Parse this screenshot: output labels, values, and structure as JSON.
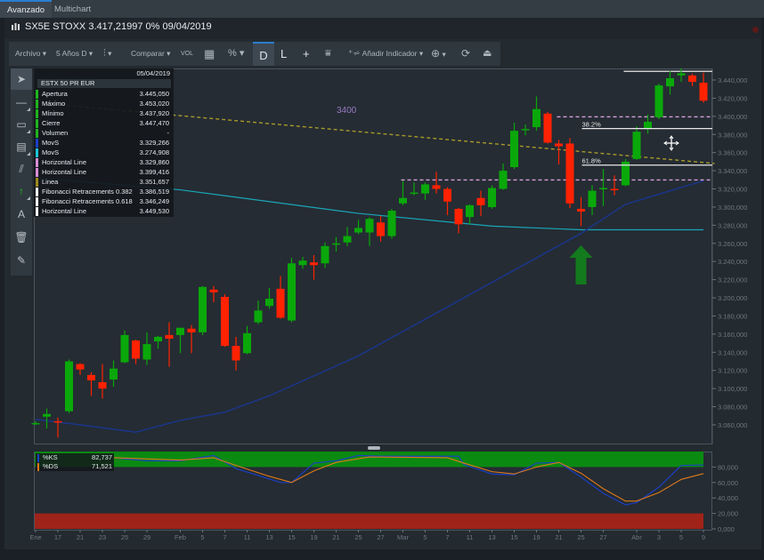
{
  "tabs": [
    {
      "label": "Avanzado",
      "active": true
    },
    {
      "label": "Multichart",
      "active": false
    }
  ],
  "header": {
    "title": "SX5E STOXX 3.417,21997 0% 09/04/2019"
  },
  "toolbar": {
    "archivo": "Archivo ▾",
    "periodo": "5 Años D ▾",
    "chart_type_caret": "▾",
    "comparar": "Comparar ▾",
    "vol": "VOL",
    "percent": "% ▾",
    "d": "D",
    "l": "L",
    "plus": "+",
    "indicator": "Añadir Indicador ▾",
    "zoom_caret": "▾"
  },
  "left_tools": [
    "cursor-icon",
    "line-icon",
    "rectangle-icon",
    "fibonacci-icon",
    "parallel-lines-icon",
    "arrow-up-icon",
    "text-icon",
    "trash-icon",
    "eraser-icon"
  ],
  "panel": {
    "date": "05/04/2019",
    "symbol": "ESTX 50 PR EUR",
    "rows": [
      {
        "label": "Apertura",
        "value": "3.445,050",
        "color": "#1fb41f"
      },
      {
        "label": "Máximo",
        "value": "3.453,020",
        "color": "#1fb41f"
      },
      {
        "label": "Mínimo",
        "value": "3.437,920",
        "color": "#1fb41f"
      },
      {
        "label": "Cierre",
        "value": "3.447,470",
        "color": "#1fb41f"
      },
      {
        "label": "Volumen",
        "value": "-",
        "color": "#1fb41f"
      },
      {
        "label": "MovS",
        "value": "3.329,266",
        "color": "#1b3fc4"
      },
      {
        "label": "MovS",
        "value": "3.274,908",
        "color": "#1cc4d8"
      },
      {
        "label": "Horizontal Line",
        "value": "3.329,860",
        "color": "#d88ed6"
      },
      {
        "label": "Horizontal Line",
        "value": "3.399,416",
        "color": "#d88ed6"
      },
      {
        "label": "Linea",
        "value": "3.351,657",
        "color": "#9c8a1c"
      },
      {
        "label": "Fibonacci Retracements 0.382",
        "value": "3.386,519",
        "color": "#f2f2f2"
      },
      {
        "label": "Fibonacci Retracements 0.618",
        "value": "3.346,249",
        "color": "#f2f2f2"
      },
      {
        "label": "Horizontal Line",
        "value": "3.449,530",
        "color": "#f2f2f2"
      }
    ]
  },
  "osc_legend": [
    {
      "label": "%KS",
      "value": "82,737",
      "color": "#1b3fc4"
    },
    {
      "label": "%DS",
      "value": "71,521",
      "color": "#e07a1a"
    }
  ],
  "annotations": {
    "price_label": "3400",
    "fib_382": "38.2%",
    "fib_618": "61.8%"
  },
  "colors": {
    "up": "#0aa80a",
    "down": "#ff2200",
    "ma_long": "#1b3585",
    "ma_short": "#1aa6b8",
    "trend": "#a89a2a",
    "hline": "#d7a0dd",
    "white": "#e8e8e8",
    "overbought": "#0b8a12",
    "oversold": "#a0231a"
  },
  "chart_data": {
    "type": "candlestick",
    "ylim": [
      3040,
      3460
    ],
    "yticks": [
      3440,
      3420,
      3400,
      3380,
      3360,
      3340,
      3320,
      3300,
      3280,
      3260,
      3240,
      3220,
      3200,
      3180,
      3160,
      3140,
      3120,
      3100,
      3080,
      3060
    ],
    "ytick_labels": [
      "3.440,000",
      "3.420,000",
      "3.400,000",
      "3.380,000",
      "3.360,000",
      "3.340,000",
      "3.320,000",
      "3.300,000",
      "3.280,000",
      "3.260,000",
      "3.240,000",
      "3.220,000",
      "3.200,000",
      "3.180,000",
      "3.160,000",
      "3.140,000",
      "3.120,000",
      "3.100,000",
      "3.080,000",
      "3.060,000"
    ],
    "xticks": [
      {
        "i": 0,
        "label": "Ene"
      },
      {
        "i": 2,
        "label": "17"
      },
      {
        "i": 4,
        "label": "21"
      },
      {
        "i": 6,
        "label": "23"
      },
      {
        "i": 8,
        "label": "25"
      },
      {
        "i": 10,
        "label": "29"
      },
      {
        "i": 13,
        "label": "Feb"
      },
      {
        "i": 15,
        "label": "5"
      },
      {
        "i": 17,
        "label": "7"
      },
      {
        "i": 19,
        "label": "11"
      },
      {
        "i": 21,
        "label": "13"
      },
      {
        "i": 23,
        "label": "15"
      },
      {
        "i": 25,
        "label": "19"
      },
      {
        "i": 27,
        "label": "21"
      },
      {
        "i": 29,
        "label": "25"
      },
      {
        "i": 31,
        "label": "27"
      },
      {
        "i": 33,
        "label": "Mar"
      },
      {
        "i": 35,
        "label": "5"
      },
      {
        "i": 37,
        "label": "7"
      },
      {
        "i": 39,
        "label": "11"
      },
      {
        "i": 41,
        "label": "13"
      },
      {
        "i": 43,
        "label": "15"
      },
      {
        "i": 45,
        "label": "19"
      },
      {
        "i": 47,
        "label": "21"
      },
      {
        "i": 49,
        "label": "25"
      },
      {
        "i": 51,
        "label": "27"
      },
      {
        "i": 54,
        "label": "Abr"
      },
      {
        "i": 56,
        "label": "3"
      },
      {
        "i": 58,
        "label": "5"
      },
      {
        "i": 60,
        "label": "9"
      }
    ],
    "ohlc": [
      [
        3062,
        3064,
        3060,
        3062
      ],
      [
        3069,
        3078,
        3056,
        3072
      ],
      [
        3064,
        3068,
        3046,
        3063
      ],
      [
        3075,
        3132,
        3073,
        3130
      ],
      [
        3127,
        3128,
        3115,
        3121
      ],
      [
        3115,
        3118,
        3092,
        3109
      ],
      [
        3107,
        3127,
        3089,
        3100
      ],
      [
        3110,
        3131,
        3102,
        3122
      ],
      [
        3129,
        3164,
        3128,
        3159
      ],
      [
        3153,
        3154,
        3127,
        3133
      ],
      [
        3132,
        3162,
        3126,
        3149
      ],
      [
        3152,
        3158,
        3144,
        3157
      ],
      [
        3159,
        3173,
        3124,
        3155
      ],
      [
        3159,
        3167,
        3139,
        3167
      ],
      [
        3166,
        3170,
        3139,
        3162
      ],
      [
        3162,
        3213,
        3159,
        3212
      ],
      [
        3209,
        3213,
        3195,
        3206
      ],
      [
        3201,
        3204,
        3146,
        3147
      ],
      [
        3147,
        3157,
        3120,
        3131
      ],
      [
        3139,
        3169,
        3138,
        3161
      ],
      [
        3173,
        3197,
        3171,
        3186
      ],
      [
        3191,
        3211,
        3188,
        3199
      ],
      [
        3210,
        3224,
        3177,
        3178
      ],
      [
        3175,
        3244,
        3173,
        3238
      ],
      [
        3236,
        3245,
        3232,
        3241
      ],
      [
        3239,
        3247,
        3220,
        3236
      ],
      [
        3238,
        3261,
        3233,
        3257
      ],
      [
        3259,
        3267,
        3251,
        3260
      ],
      [
        3261,
        3278,
        3257,
        3268
      ],
      [
        3272,
        3286,
        3270,
        3277
      ],
      [
        3272,
        3289,
        3257,
        3287
      ],
      [
        3283,
        3290,
        3262,
        3268
      ],
      [
        3268,
        3298,
        3265,
        3296
      ],
      [
        3304,
        3329,
        3302,
        3310
      ],
      [
        3315,
        3327,
        3313,
        3316
      ],
      [
        3315,
        3327,
        3308,
        3325
      ],
      [
        3324,
        3339,
        3315,
        3320
      ],
      [
        3320,
        3322,
        3291,
        3306
      ],
      [
        3298,
        3299,
        3271,
        3281
      ],
      [
        3289,
        3303,
        3281,
        3302
      ],
      [
        3310,
        3318,
        3290,
        3302
      ],
      [
        3300,
        3324,
        3298,
        3321
      ],
      [
        3320,
        3348,
        3319,
        3340
      ],
      [
        3344,
        3393,
        3342,
        3384
      ],
      [
        3385,
        3391,
        3379,
        3386
      ],
      [
        3388,
        3422,
        3384,
        3408
      ],
      [
        3403,
        3405,
        3370,
        3371
      ],
      [
        3370,
        3374,
        3347,
        3367
      ],
      [
        3370,
        3376,
        3299,
        3304
      ],
      [
        3298,
        3311,
        3279,
        3295
      ],
      [
        3300,
        3324,
        3291,
        3318
      ],
      [
        3320,
        3342,
        3301,
        3321
      ],
      [
        3320,
        3335,
        3313,
        3319
      ],
      [
        3324,
        3353,
        3323,
        3350
      ],
      [
        3353,
        3389,
        3352,
        3383
      ],
      [
        3386,
        3402,
        3381,
        3394
      ],
      [
        3399,
        3436,
        3397,
        3434
      ],
      [
        3433,
        3450,
        3424,
        3442
      ],
      [
        3445.05,
        3453.02,
        3437.92,
        3447.47
      ],
      [
        3445,
        3447,
        3433,
        3438
      ],
      [
        3437,
        3448,
        3415,
        3417.22
      ]
    ],
    "ma_long": [
      [
        0,
        3066
      ],
      [
        4,
        3060
      ],
      [
        9,
        3052
      ],
      [
        13,
        3065
      ],
      [
        17,
        3074
      ],
      [
        21,
        3092
      ],
      [
        29,
        3136
      ],
      [
        37,
        3190
      ],
      [
        45,
        3244
      ],
      [
        49,
        3271
      ],
      [
        53,
        3303
      ],
      [
        60,
        3329
      ]
    ],
    "ma_short": [
      [
        0,
        3332
      ],
      [
        13,
        3319
      ],
      [
        29,
        3293
      ],
      [
        41,
        3279
      ],
      [
        49,
        3275
      ],
      [
        60,
        3275
      ]
    ],
    "trendline": [
      [
        0,
        3415
      ],
      [
        61,
        3348
      ]
    ],
    "hlines": [
      {
        "from": 33,
        "price": 3329.86,
        "style": "dashed",
        "color": "hline"
      },
      {
        "from": 47,
        "price": 3399.416,
        "style": "dashed",
        "color": "hline"
      },
      {
        "from": 53,
        "price": 3449.53,
        "style": "solid",
        "color": "white"
      }
    ],
    "fib": {
      "from": 49,
      "levels": [
        {
          "price": 3386.519,
          "label": "38.2%"
        },
        {
          "price": 3346.249,
          "label": "61.8%"
        }
      ]
    },
    "arrow_at": 49,
    "stochastic": {
      "yticks": [
        80,
        60,
        40,
        20,
        0
      ],
      "ytick_labels": [
        "80,000",
        "60,000",
        "40,000",
        "20,000",
        "0,000"
      ],
      "k": [
        [
          7,
          92
        ],
        [
          10,
          88
        ],
        [
          13,
          88
        ],
        [
          16,
          95
        ],
        [
          18,
          78
        ],
        [
          20,
          69
        ],
        [
          22,
          60
        ],
        [
          23,
          60
        ],
        [
          25,
          85
        ],
        [
          27,
          88
        ],
        [
          29,
          95
        ],
        [
          31,
          94
        ],
        [
          38,
          94
        ],
        [
          38.5,
          83
        ],
        [
          41,
          71
        ],
        [
          43,
          70
        ],
        [
          45,
          85
        ],
        [
          47,
          86
        ],
        [
          49,
          67
        ],
        [
          51,
          46
        ],
        [
          53,
          31
        ],
        [
          54,
          34
        ],
        [
          56,
          54
        ],
        [
          58,
          82
        ],
        [
          60,
          82.7
        ]
      ],
      "d": [
        [
          7,
          92
        ],
        [
          13,
          89
        ],
        [
          16,
          92
        ],
        [
          18,
          82
        ],
        [
          21,
          68
        ],
        [
          23,
          60
        ],
        [
          25,
          75
        ],
        [
          27,
          86
        ],
        [
          30,
          93
        ],
        [
          37,
          92
        ],
        [
          38.5,
          85
        ],
        [
          41,
          74
        ],
        [
          43,
          71
        ],
        [
          45,
          80
        ],
        [
          47,
          86
        ],
        [
          49,
          72
        ],
        [
          51,
          52
        ],
        [
          53,
          36
        ],
        [
          54,
          36
        ],
        [
          56,
          47
        ],
        [
          58,
          64
        ],
        [
          60,
          71.5
        ]
      ]
    }
  }
}
